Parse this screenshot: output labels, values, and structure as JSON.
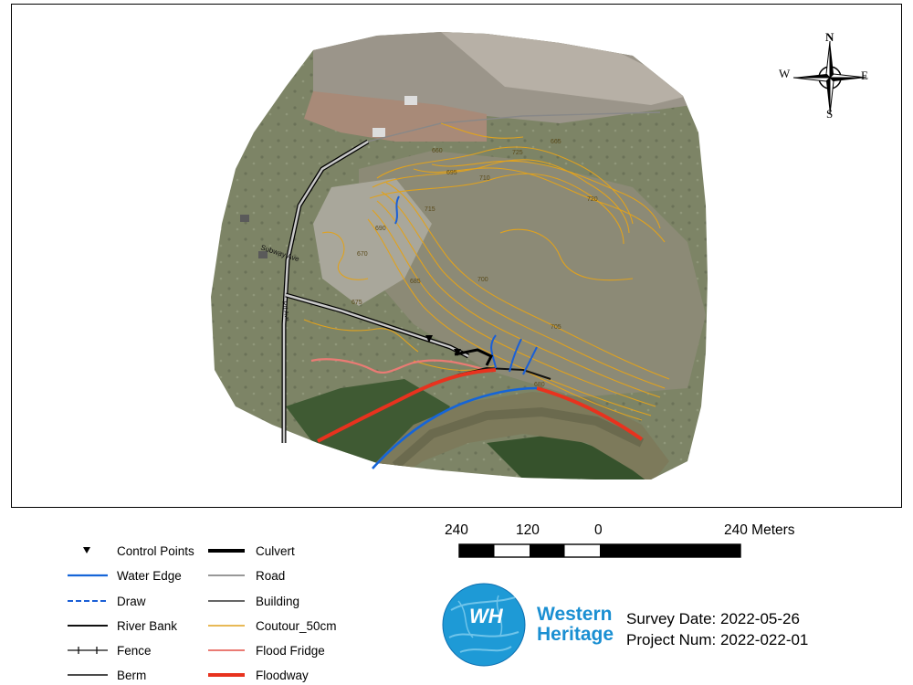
{
  "map": {
    "compass": {
      "north": "N",
      "south": "S",
      "east": "E",
      "west": "W"
    },
    "contour_labels": [
      "660",
      "665",
      "670",
      "675",
      "680",
      "685",
      "690",
      "695",
      "700",
      "705",
      "710",
      "715",
      "720",
      "725"
    ],
    "road_labels": [
      "Subway Ave",
      "Rd Ave"
    ],
    "colors": {
      "water_edge": "#1565d8",
      "draw": "#1a5fd6",
      "river_bank": "#111111",
      "road": "#666666",
      "building": "#333333",
      "contour": "#e0a21e",
      "flood_fringe": "#ea7b74",
      "floodway": "#e8321e",
      "culvert": "#000000"
    }
  },
  "legend": {
    "left": [
      {
        "label": "Control Points",
        "symbol": "triangle-down-icon"
      },
      {
        "label": "Water Edge",
        "symbol": "line-blue"
      },
      {
        "label": "Draw",
        "symbol": "line-blue-dashed"
      },
      {
        "label": "River Bank",
        "symbol": "line-black"
      },
      {
        "label": "Fence",
        "symbol": "line-fence"
      },
      {
        "label": "Berm",
        "symbol": "line-black-thin"
      }
    ],
    "right": [
      {
        "label": "Culvert",
        "symbol": "line-black-thick"
      },
      {
        "label": "Road",
        "symbol": "line-gray"
      },
      {
        "label": "Building",
        "symbol": "line-dark"
      },
      {
        "label": "Coutour_50cm",
        "symbol": "line-orange"
      },
      {
        "label": "Flood Fridge",
        "symbol": "line-pink"
      },
      {
        "label": "Floodway",
        "symbol": "line-red-thick"
      }
    ]
  },
  "scale_bar": {
    "labels": [
      "240",
      "120",
      "0",
      "240 Meters"
    ],
    "segments": 8
  },
  "logo": {
    "initials": "WH",
    "line1": "Western",
    "line2": "Heritage",
    "colors": {
      "outer": "#1e9ad6",
      "inner": "#6fc4ea",
      "accent": "#0d6fb0"
    }
  },
  "survey": {
    "date_label": "Survey Date: 2022-05-26",
    "project_label": "Project Num: 2022-022-01"
  }
}
